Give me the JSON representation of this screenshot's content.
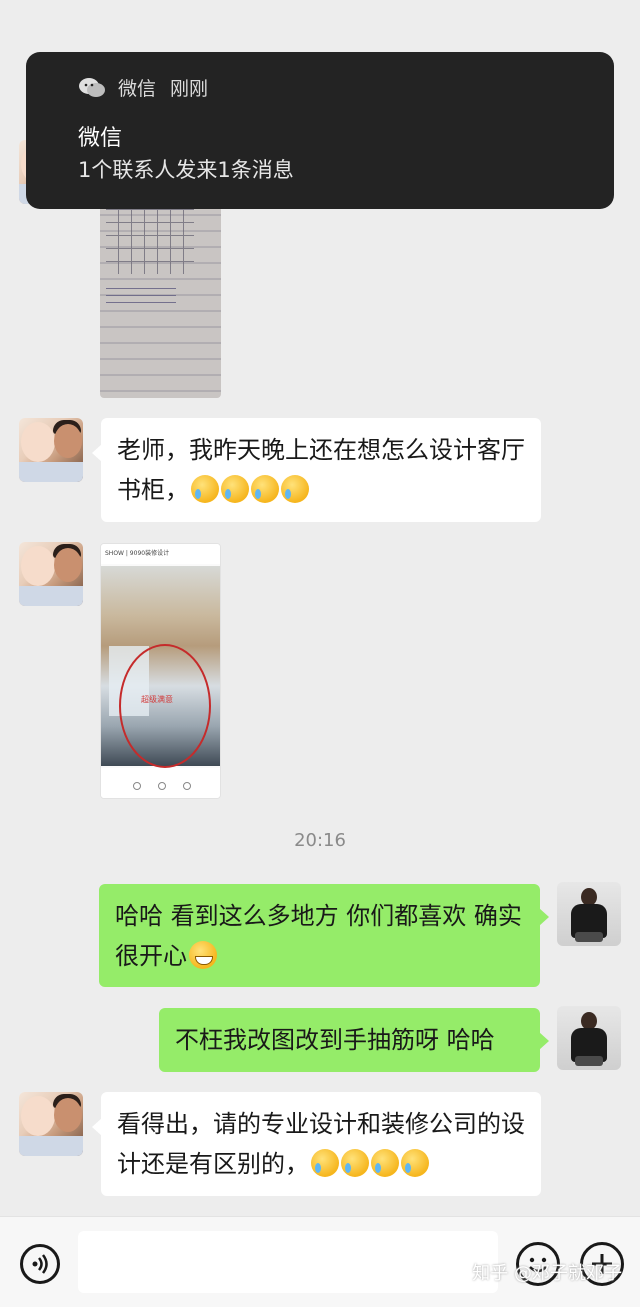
{
  "notification": {
    "app_name": "微信",
    "time": "刚刚",
    "title": "微信",
    "body": "1个联系人发来1条消息"
  },
  "messages": [
    {
      "side": "left",
      "type": "text",
      "text": "老师，我昨天晚上还在想怎么设计客厅书柜，",
      "emoji_count": 4,
      "emoji": "laugh-cry"
    },
    {
      "side": "left",
      "type": "image",
      "caption": "超级满意"
    },
    {
      "type": "timestamp",
      "text": "20:16"
    },
    {
      "side": "right",
      "type": "text",
      "text": "哈哈 看到这么多地方 你们都喜欢 确实很开心",
      "emoji_count": 1,
      "emoji": "grin"
    },
    {
      "side": "right",
      "type": "text",
      "text": "不枉我改图改到手抽筋呀 哈哈"
    },
    {
      "side": "left",
      "type": "text",
      "text": "看得出，请的专业设计和装修公司的设计还是有区别的，",
      "emoji_count": 4,
      "emoji": "laugh-cry"
    }
  ],
  "phone_image": {
    "topbar": "SHOW | 9090装修设计"
  },
  "input_bar": {
    "voice_icon": "voice-icon",
    "emoji_icon": "smiley-icon",
    "plus_icon": "plus-icon"
  },
  "watermark": "知乎 @邓子就邓子"
}
